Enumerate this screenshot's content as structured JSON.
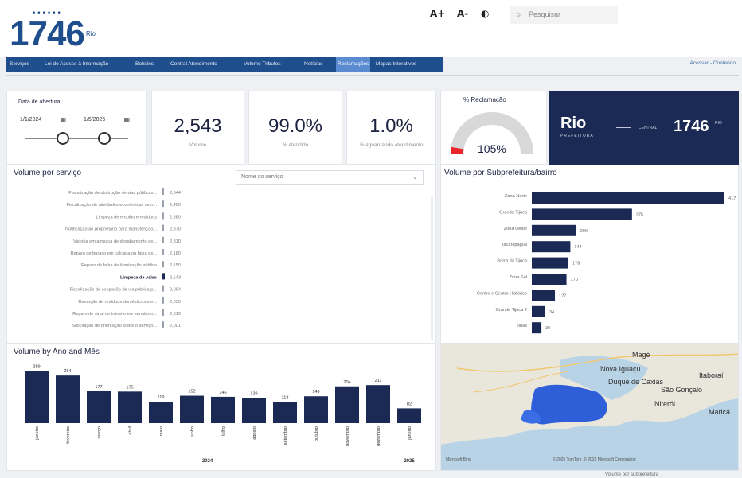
{
  "header": {
    "logo_number": "1746",
    "logo_dots": "••••••",
    "logo_subtitle": "Rio",
    "tools": [
      "A+",
      "A-",
      "◐"
    ],
    "search_placeholder": "Pesquisar",
    "nav": [
      "Serviços",
      "Lei de Acesso à Informação",
      "Boletins",
      "Central Atendimento",
      "Volume Tributos",
      "Notícias",
      "Reclamações",
      "Mapas Interativos"
    ],
    "active_nav_index": 6,
    "top_link": "Acessar - Conteúdo"
  },
  "filter": {
    "title": "Data de abertura",
    "date_start": "1/1/2024",
    "date_end": "1/5/2025",
    "calendar_icon": "calendar-icon"
  },
  "kpis": [
    {
      "value": "2,543",
      "label": "Volume"
    },
    {
      "value": "99.0%",
      "label": "% atendido"
    },
    {
      "value": "1.0%",
      "label": "% aguardando atendimento"
    }
  ],
  "gauge": {
    "title": "% Reclamação",
    "value_label": "105%",
    "fraction": 0.05,
    "colors": {
      "track": "#d8d8d8",
      "fill": "#e8262b"
    }
  },
  "brand": {
    "rio": "Rio",
    "prefeitura": "PREFEITURA",
    "mid_text": "CENTRAL",
    "number": "1746",
    "number_sub": "RIO"
  },
  "volume_servico": {
    "title": "Volume por serviço",
    "dropdown_placeholder": "Nome do serviço",
    "rows": [
      {
        "label": "Fiscalização de obstrução de vias públicas...",
        "value": "2,644"
      },
      {
        "label": "Fiscalização de atividades econômicas sem...",
        "value": "2,460"
      },
      {
        "label": "Limpeza de entulho e resíduos",
        "value": "2,380"
      },
      {
        "label": "Notificação ao proprietário para manutenção...",
        "value": "2,370"
      },
      {
        "label": "Vistoria em ameaça de desabamento de...",
        "value": "2,310"
      },
      {
        "label": "Reparo de buraco em calçada ou faixa de...",
        "value": "2,180"
      },
      {
        "label": "Reparo de falha de iluminação pública",
        "value": "2,150"
      },
      {
        "label": "Limpeza de valas",
        "value": "2,543",
        "highlight": true
      },
      {
        "label": "Fiscalização de ocupação de via pública p...",
        "value": "2,094"
      },
      {
        "label": "Remoção de resíduos domésticos e e...",
        "value": "2,030"
      },
      {
        "label": "Reparo de sinal de trânsito em semáforo...",
        "value": "2,010"
      },
      {
        "label": "Solicitação de orientação sobre o serviço...",
        "value": "2,001"
      }
    ]
  },
  "volume_subpref": {
    "title": "Volume por Subprefeitura/bairro",
    "chart_data": {
      "type": "bar",
      "orientation": "horizontal",
      "categories": [
        "Zona Norte",
        "Grande Tijuca",
        "Zona Oeste",
        "Jacarepaguá",
        "Barra da Tijuca",
        "Zona Sul",
        "Centro e Centro Histórico",
        "Grande Tijuca 2",
        "Ilhas"
      ],
      "value_labels": [
        "417",
        "275",
        "290",
        "144",
        "178",
        "170",
        "127",
        "34",
        "30"
      ],
      "values": [
        417,
        275,
        290,
        144,
        178,
        170,
        127,
        34,
        30
      ],
      "widths_frac": [
        1.0,
        0.52,
        0.23,
        0.2,
        0.19,
        0.18,
        0.12,
        0.07,
        0.05
      ],
      "bar_color": "#1b2a54"
    }
  },
  "volume_ano_mes": {
    "title": "Volume by Ano and Mês",
    "chart_data": {
      "type": "bar",
      "categories": [
        "janeiro",
        "fevereiro",
        "março",
        "abril",
        "maio",
        "junho",
        "julho",
        "agosto",
        "setembro",
        "outubro",
        "novembro",
        "dezembro",
        "janeiro"
      ],
      "values": [
        289,
        264,
        177,
        175,
        119,
        152,
        146,
        139,
        118,
        149,
        204,
        211,
        82
      ],
      "value_labels": [
        "289",
        "264",
        "177",
        "175",
        "119",
        "152",
        "146",
        "139",
        "118",
        "149",
        "204",
        "211",
        "82"
      ],
      "years": [
        {
          "label": "2024",
          "start": 0,
          "end": 11
        },
        {
          "label": "2025",
          "start": 12,
          "end": 12
        }
      ],
      "bar_color": "#1b2a54",
      "ylim": [
        0,
        300
      ]
    }
  },
  "map": {
    "labels": [
      "Magé",
      "Nova Iguaçu",
      "Duque de Caxias",
      "São Gonçalo",
      "Itaboraí",
      "Niterói",
      "Maricá"
    ],
    "copyright": "© 2025 TomTom, © 2025 Microsoft Corporation",
    "logo_text": "Microsoft Bing",
    "footer": "Volume por subprefeitura"
  }
}
